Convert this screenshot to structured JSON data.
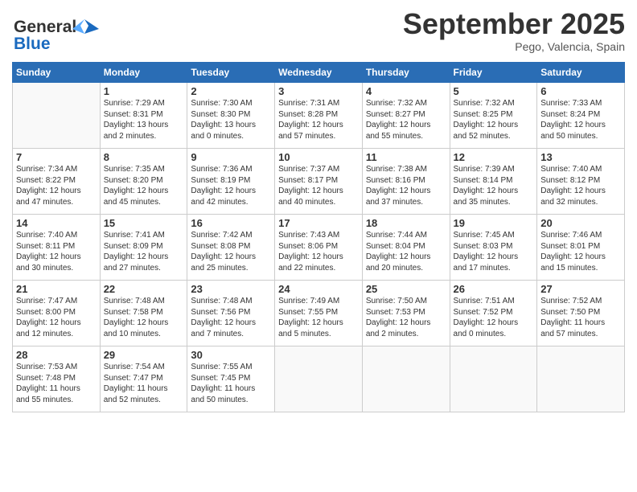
{
  "header": {
    "logo_line1": "General",
    "logo_line2": "Blue",
    "month": "September 2025",
    "location": "Pego, Valencia, Spain"
  },
  "days_of_week": [
    "Sunday",
    "Monday",
    "Tuesday",
    "Wednesday",
    "Thursday",
    "Friday",
    "Saturday"
  ],
  "weeks": [
    [
      {
        "day": "",
        "info": ""
      },
      {
        "day": "1",
        "info": "Sunrise: 7:29 AM\nSunset: 8:31 PM\nDaylight: 13 hours\nand 2 minutes."
      },
      {
        "day": "2",
        "info": "Sunrise: 7:30 AM\nSunset: 8:30 PM\nDaylight: 13 hours\nand 0 minutes."
      },
      {
        "day": "3",
        "info": "Sunrise: 7:31 AM\nSunset: 8:28 PM\nDaylight: 12 hours\nand 57 minutes."
      },
      {
        "day": "4",
        "info": "Sunrise: 7:32 AM\nSunset: 8:27 PM\nDaylight: 12 hours\nand 55 minutes."
      },
      {
        "day": "5",
        "info": "Sunrise: 7:32 AM\nSunset: 8:25 PM\nDaylight: 12 hours\nand 52 minutes."
      },
      {
        "day": "6",
        "info": "Sunrise: 7:33 AM\nSunset: 8:24 PM\nDaylight: 12 hours\nand 50 minutes."
      }
    ],
    [
      {
        "day": "7",
        "info": "Sunrise: 7:34 AM\nSunset: 8:22 PM\nDaylight: 12 hours\nand 47 minutes."
      },
      {
        "day": "8",
        "info": "Sunrise: 7:35 AM\nSunset: 8:20 PM\nDaylight: 12 hours\nand 45 minutes."
      },
      {
        "day": "9",
        "info": "Sunrise: 7:36 AM\nSunset: 8:19 PM\nDaylight: 12 hours\nand 42 minutes."
      },
      {
        "day": "10",
        "info": "Sunrise: 7:37 AM\nSunset: 8:17 PM\nDaylight: 12 hours\nand 40 minutes."
      },
      {
        "day": "11",
        "info": "Sunrise: 7:38 AM\nSunset: 8:16 PM\nDaylight: 12 hours\nand 37 minutes."
      },
      {
        "day": "12",
        "info": "Sunrise: 7:39 AM\nSunset: 8:14 PM\nDaylight: 12 hours\nand 35 minutes."
      },
      {
        "day": "13",
        "info": "Sunrise: 7:40 AM\nSunset: 8:12 PM\nDaylight: 12 hours\nand 32 minutes."
      }
    ],
    [
      {
        "day": "14",
        "info": "Sunrise: 7:40 AM\nSunset: 8:11 PM\nDaylight: 12 hours\nand 30 minutes."
      },
      {
        "day": "15",
        "info": "Sunrise: 7:41 AM\nSunset: 8:09 PM\nDaylight: 12 hours\nand 27 minutes."
      },
      {
        "day": "16",
        "info": "Sunrise: 7:42 AM\nSunset: 8:08 PM\nDaylight: 12 hours\nand 25 minutes."
      },
      {
        "day": "17",
        "info": "Sunrise: 7:43 AM\nSunset: 8:06 PM\nDaylight: 12 hours\nand 22 minutes."
      },
      {
        "day": "18",
        "info": "Sunrise: 7:44 AM\nSunset: 8:04 PM\nDaylight: 12 hours\nand 20 minutes."
      },
      {
        "day": "19",
        "info": "Sunrise: 7:45 AM\nSunset: 8:03 PM\nDaylight: 12 hours\nand 17 minutes."
      },
      {
        "day": "20",
        "info": "Sunrise: 7:46 AM\nSunset: 8:01 PM\nDaylight: 12 hours\nand 15 minutes."
      }
    ],
    [
      {
        "day": "21",
        "info": "Sunrise: 7:47 AM\nSunset: 8:00 PM\nDaylight: 12 hours\nand 12 minutes."
      },
      {
        "day": "22",
        "info": "Sunrise: 7:48 AM\nSunset: 7:58 PM\nDaylight: 12 hours\nand 10 minutes."
      },
      {
        "day": "23",
        "info": "Sunrise: 7:48 AM\nSunset: 7:56 PM\nDaylight: 12 hours\nand 7 minutes."
      },
      {
        "day": "24",
        "info": "Sunrise: 7:49 AM\nSunset: 7:55 PM\nDaylight: 12 hours\nand 5 minutes."
      },
      {
        "day": "25",
        "info": "Sunrise: 7:50 AM\nSunset: 7:53 PM\nDaylight: 12 hours\nand 2 minutes."
      },
      {
        "day": "26",
        "info": "Sunrise: 7:51 AM\nSunset: 7:52 PM\nDaylight: 12 hours\nand 0 minutes."
      },
      {
        "day": "27",
        "info": "Sunrise: 7:52 AM\nSunset: 7:50 PM\nDaylight: 11 hours\nand 57 minutes."
      }
    ],
    [
      {
        "day": "28",
        "info": "Sunrise: 7:53 AM\nSunset: 7:48 PM\nDaylight: 11 hours\nand 55 minutes."
      },
      {
        "day": "29",
        "info": "Sunrise: 7:54 AM\nSunset: 7:47 PM\nDaylight: 11 hours\nand 52 minutes."
      },
      {
        "day": "30",
        "info": "Sunrise: 7:55 AM\nSunset: 7:45 PM\nDaylight: 11 hours\nand 50 minutes."
      },
      {
        "day": "",
        "info": ""
      },
      {
        "day": "",
        "info": ""
      },
      {
        "day": "",
        "info": ""
      },
      {
        "day": "",
        "info": ""
      }
    ]
  ]
}
